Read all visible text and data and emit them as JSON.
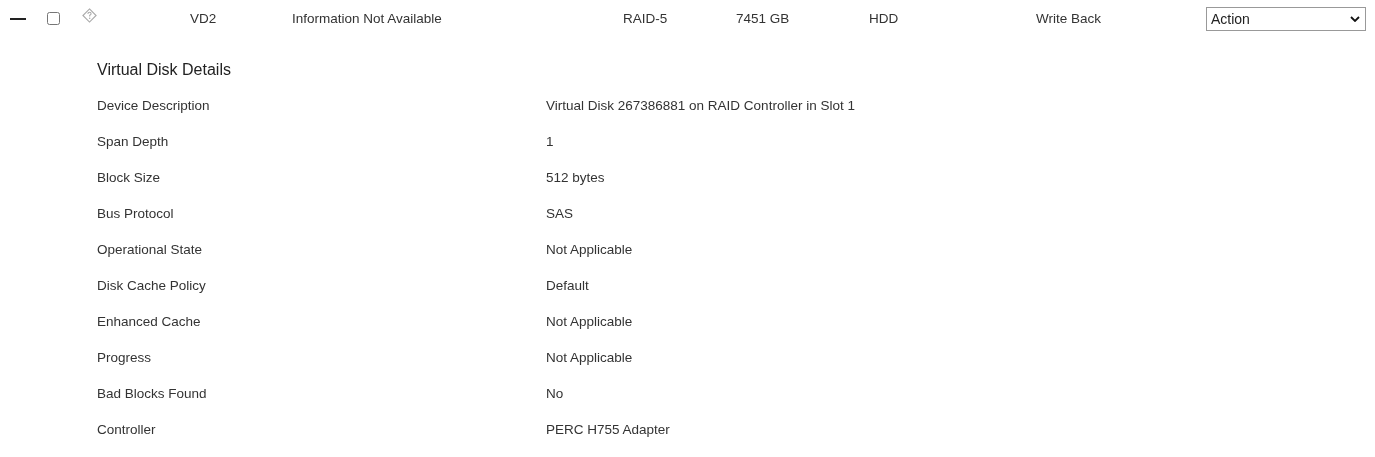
{
  "virtual_disk": {
    "expanded": true,
    "checked": false,
    "name": "VD2",
    "status": "Information Not Available",
    "layout": "RAID-5",
    "size": "7451 GB",
    "media_type": "HDD",
    "write_policy": "Write Back",
    "action": {
      "value": "Action"
    }
  },
  "details": {
    "title": "Virtual Disk Details",
    "rows": [
      {
        "label": "Device Description",
        "value": "Virtual Disk 267386881 on RAID Controller in Slot 1"
      },
      {
        "label": "Span Depth",
        "value": "1"
      },
      {
        "label": "Block Size",
        "value": "512 bytes"
      },
      {
        "label": "Bus Protocol",
        "value": "SAS"
      },
      {
        "label": "Operational State",
        "value": "Not Applicable"
      },
      {
        "label": "Disk Cache Policy",
        "value": "Default"
      },
      {
        "label": "Enhanced Cache",
        "value": "Not Applicable"
      },
      {
        "label": "Progress",
        "value": "Not Applicable"
      },
      {
        "label": "Bad Blocks Found",
        "value": "No"
      },
      {
        "label": "Controller",
        "value": "PERC H755 Adapter"
      }
    ]
  }
}
